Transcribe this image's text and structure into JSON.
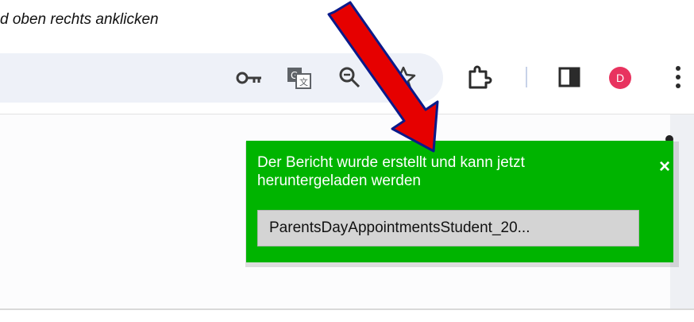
{
  "caption": "d oben rechts anklicken",
  "toolbar": {
    "icons": [
      "key-icon",
      "translate-icon",
      "zoom-icon",
      "star-icon",
      "extensions-icon",
      "side-panel-icon",
      "more-menu-icon"
    ],
    "avatar_letter": "D"
  },
  "toast": {
    "message": "Der Bericht wurde erstellt und kann jetzt heruntergeladen werden",
    "close_label": "×",
    "file_label": "ParentsDayAppointmentsStudent_20...",
    "background": "#00b400"
  },
  "annotation": {
    "arrow_color": "#e60000"
  }
}
